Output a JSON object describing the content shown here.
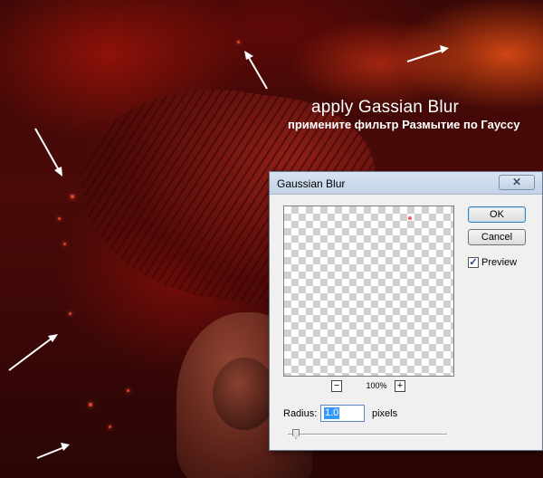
{
  "annotations": {
    "caption_en": "apply Gassian Blur",
    "caption_ru": "примените фильтр Размытие по Гауссу"
  },
  "dialog": {
    "title": "Gaussian Blur",
    "close_icon": "close-icon",
    "ok_label": "OK",
    "cancel_label": "Cancel",
    "preview_label": "Preview",
    "preview_checked": true,
    "zoom_out_label": "−",
    "zoom_in_label": "+",
    "zoom_level": "100%",
    "radius_label": "Radius:",
    "radius_value": "1.0",
    "radius_units": "pixels"
  },
  "colors": {
    "background_accent": "#8a0f0a",
    "annotation_text": "#ffffff",
    "dialog_bg": "#f0f0f0",
    "selection": "#3399ff"
  }
}
